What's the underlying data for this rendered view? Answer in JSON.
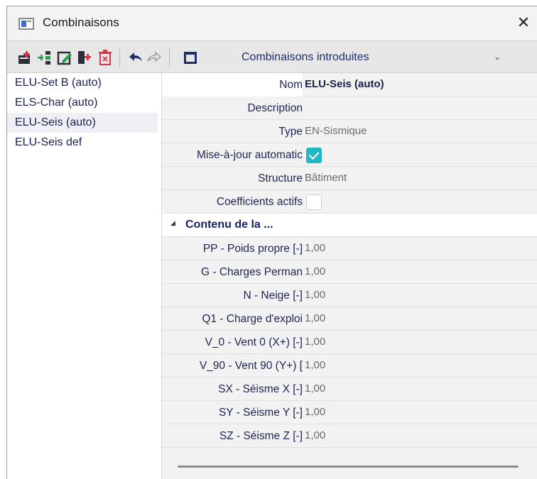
{
  "window": {
    "title": "Combinaisons",
    "close_glyph": "✕",
    "icon": "app-window-icon"
  },
  "toolbar": {
    "icons": [
      "new-combination-icon",
      "insert-icon",
      "edit-icon",
      "copy-icon",
      "delete-icon",
      "undo-icon",
      "redo-icon",
      "table-icon"
    ],
    "combo_value": "Combinaisons introduites",
    "combo_arrow": "⌄"
  },
  "list": {
    "items": [
      {
        "label": "ELU-Set B (auto)"
      },
      {
        "label": "ELS-Char (auto)"
      },
      {
        "label": "ELU-Seis (auto)"
      },
      {
        "label": "ELU-Seis def"
      }
    ],
    "selected_index": 2
  },
  "properties": {
    "nom": {
      "label": "Nom",
      "value": "ELU-Seis (auto)"
    },
    "description": {
      "label": "Description",
      "value": ""
    },
    "type": {
      "label": "Type",
      "value": "EN-Sismique"
    },
    "maj": {
      "label": "Mise-à-jour automatic",
      "checked": true
    },
    "structure": {
      "label": "Structure",
      "value": "Bâtiment"
    },
    "coefficients": {
      "label": "Coefficients actifs",
      "checked": false
    },
    "section": {
      "arrow": "◢",
      "title": "Contenu de la ..."
    },
    "loads": [
      {
        "label": "PP - Poids propre [-]",
        "value": "1,00"
      },
      {
        "label": "G - Charges Perman",
        "value": "1,00"
      },
      {
        "label": "N - Neige [-]",
        "value": "1,00"
      },
      {
        "label": "Q1 - Charge d'exploi",
        "value": "1,00"
      },
      {
        "label": "V_0 - Vent 0 (X+) [-]",
        "value": "1,00"
      },
      {
        "label": "V_90 - Vent 90 (Y+) [",
        "value": "1,00"
      },
      {
        "label": "SX - Séisme X [-]",
        "value": "1,00"
      },
      {
        "label": "SY - Séisme Y [-]",
        "value": "1,00"
      },
      {
        "label": "SZ - Séisme Z [-]",
        "value": "1,00"
      }
    ]
  },
  "colors": {
    "accent": "#22b7c7",
    "label_text": "#1d2550",
    "toolbar_bg": "#e7e7e7"
  }
}
